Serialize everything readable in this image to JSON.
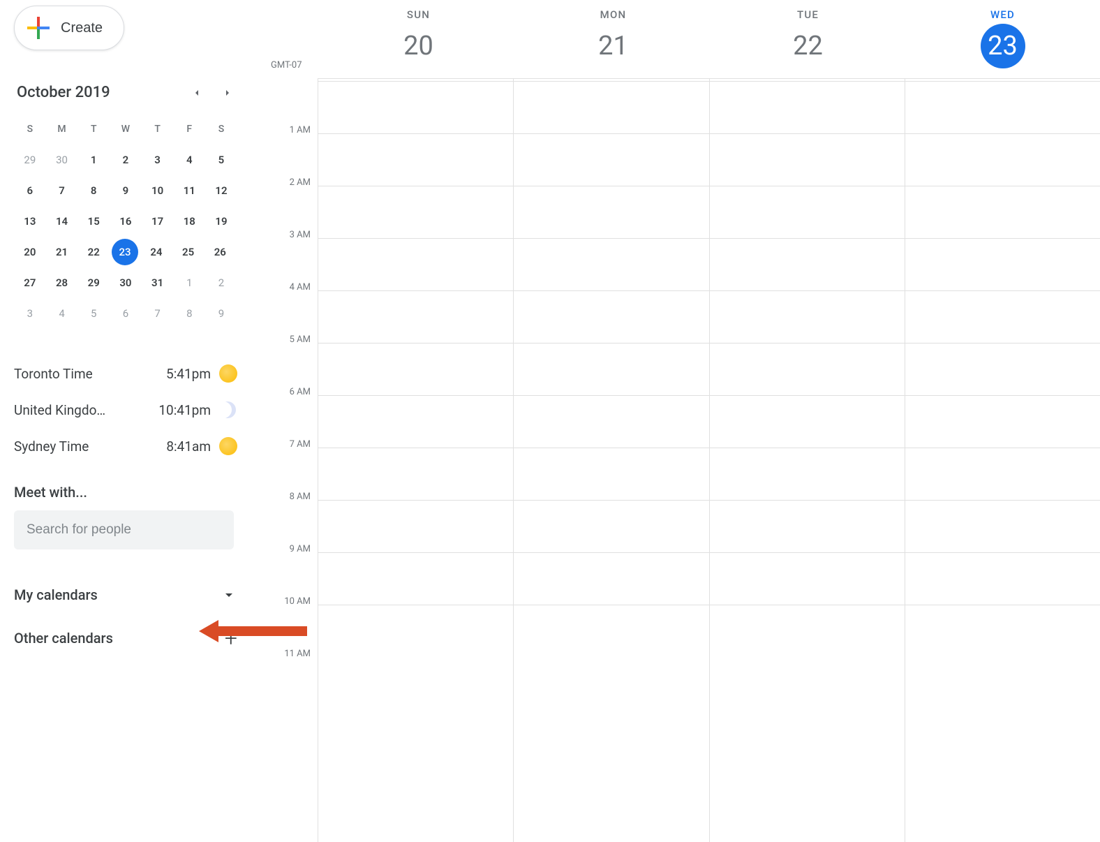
{
  "create_button_label": "Create",
  "mini_calendar": {
    "title": "October 2019",
    "dow": [
      "S",
      "M",
      "T",
      "W",
      "T",
      "F",
      "S"
    ],
    "weeks": [
      [
        {
          "n": "29",
          "t": "out"
        },
        {
          "n": "30",
          "t": "out"
        },
        {
          "n": "1",
          "t": "in"
        },
        {
          "n": "2",
          "t": "in"
        },
        {
          "n": "3",
          "t": "in"
        },
        {
          "n": "4",
          "t": "in"
        },
        {
          "n": "5",
          "t": "in"
        }
      ],
      [
        {
          "n": "6",
          "t": "in"
        },
        {
          "n": "7",
          "t": "in"
        },
        {
          "n": "8",
          "t": "in"
        },
        {
          "n": "9",
          "t": "in"
        },
        {
          "n": "10",
          "t": "in"
        },
        {
          "n": "11",
          "t": "in"
        },
        {
          "n": "12",
          "t": "in"
        }
      ],
      [
        {
          "n": "13",
          "t": "in"
        },
        {
          "n": "14",
          "t": "in"
        },
        {
          "n": "15",
          "t": "in"
        },
        {
          "n": "16",
          "t": "in"
        },
        {
          "n": "17",
          "t": "in"
        },
        {
          "n": "18",
          "t": "in"
        },
        {
          "n": "19",
          "t": "in"
        }
      ],
      [
        {
          "n": "20",
          "t": "in"
        },
        {
          "n": "21",
          "t": "in"
        },
        {
          "n": "22",
          "t": "in"
        },
        {
          "n": "23",
          "t": "today"
        },
        {
          "n": "24",
          "t": "in"
        },
        {
          "n": "25",
          "t": "in"
        },
        {
          "n": "26",
          "t": "in"
        }
      ],
      [
        {
          "n": "27",
          "t": "in"
        },
        {
          "n": "28",
          "t": "in"
        },
        {
          "n": "29",
          "t": "in"
        },
        {
          "n": "30",
          "t": "in"
        },
        {
          "n": "31",
          "t": "in"
        },
        {
          "n": "1",
          "t": "out"
        },
        {
          "n": "2",
          "t": "out"
        }
      ],
      [
        {
          "n": "3",
          "t": "out"
        },
        {
          "n": "4",
          "t": "out"
        },
        {
          "n": "5",
          "t": "out"
        },
        {
          "n": "6",
          "t": "out"
        },
        {
          "n": "7",
          "t": "out"
        },
        {
          "n": "8",
          "t": "out"
        },
        {
          "n": "9",
          "t": "out"
        }
      ]
    ]
  },
  "world_clocks": [
    {
      "label": "Toronto Time",
      "time": "5:41pm",
      "icon": "sun"
    },
    {
      "label": "United Kingdo…",
      "time": "10:41pm",
      "icon": "moon"
    },
    {
      "label": "Sydney Time",
      "time": "8:41am",
      "icon": "sun"
    }
  ],
  "meet_with_label": "Meet with...",
  "search_placeholder": "Search for people",
  "my_calendars_label": "My calendars",
  "other_calendars_label": "Other calendars",
  "timezone_label": "GMT-07",
  "day_headers": [
    {
      "dow": "SUN",
      "num": "20",
      "today": false
    },
    {
      "dow": "MON",
      "num": "21",
      "today": false
    },
    {
      "dow": "TUE",
      "num": "22",
      "today": false
    },
    {
      "dow": "WED",
      "num": "23",
      "today": true
    }
  ],
  "hours": [
    "1 AM",
    "2 AM",
    "3 AM",
    "4 AM",
    "5 AM",
    "6 AM",
    "7 AM",
    "8 AM",
    "9 AM",
    "10 AM",
    "11 AM"
  ],
  "colors": {
    "accent": "#1a73e8",
    "arrow": "#d94b25"
  }
}
